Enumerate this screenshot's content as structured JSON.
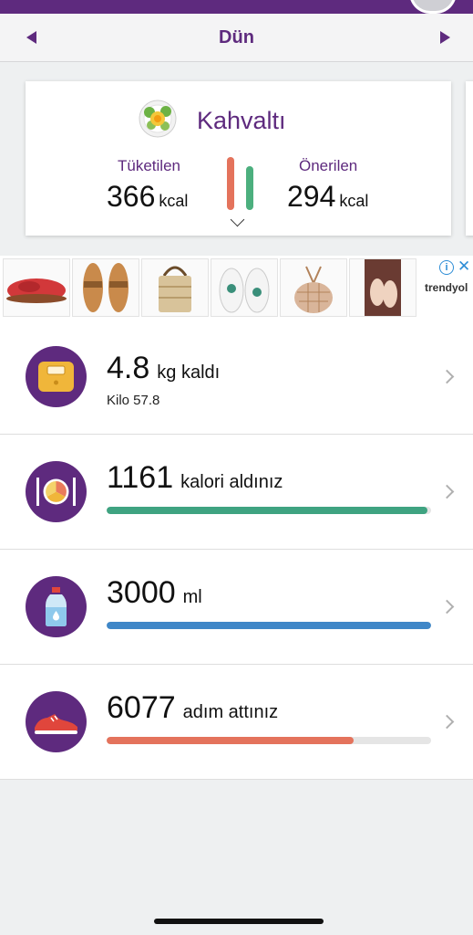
{
  "header": {
    "date_label": "Dün"
  },
  "meal": {
    "title": "Kahvaltı",
    "consumed_label": "Tüketilen",
    "consumed_value": "366",
    "consumed_unit": "kcal",
    "recommended_label": "Önerilen",
    "recommended_value": "294",
    "recommended_unit": "kcal",
    "consumed_color": "#e4735c",
    "recommended_color": "#4caf7e"
  },
  "ad": {
    "brand": "trendyol",
    "items": [
      "red-clog",
      "brown-sandal",
      "straw-bag",
      "printed-sneakers",
      "net-bag",
      "flat-sandal"
    ]
  },
  "rows": {
    "weight": {
      "value": "4.8",
      "label": "kg kaldı",
      "sub": "Kilo 57.8",
      "icon": "scale-icon"
    },
    "calories": {
      "value": "1161",
      "label": "kalori aldınız",
      "progress": 0.99,
      "color": "#3fa381",
      "icon": "plate-icon"
    },
    "water": {
      "value": "3000",
      "label": "ml",
      "progress": 1.0,
      "color": "#3f87c8",
      "icon": "water-bottle-icon"
    },
    "steps": {
      "value": "6077",
      "label": "adım attınız",
      "progress": 0.76,
      "color": "#e4735c",
      "icon": "sneaker-icon"
    }
  }
}
